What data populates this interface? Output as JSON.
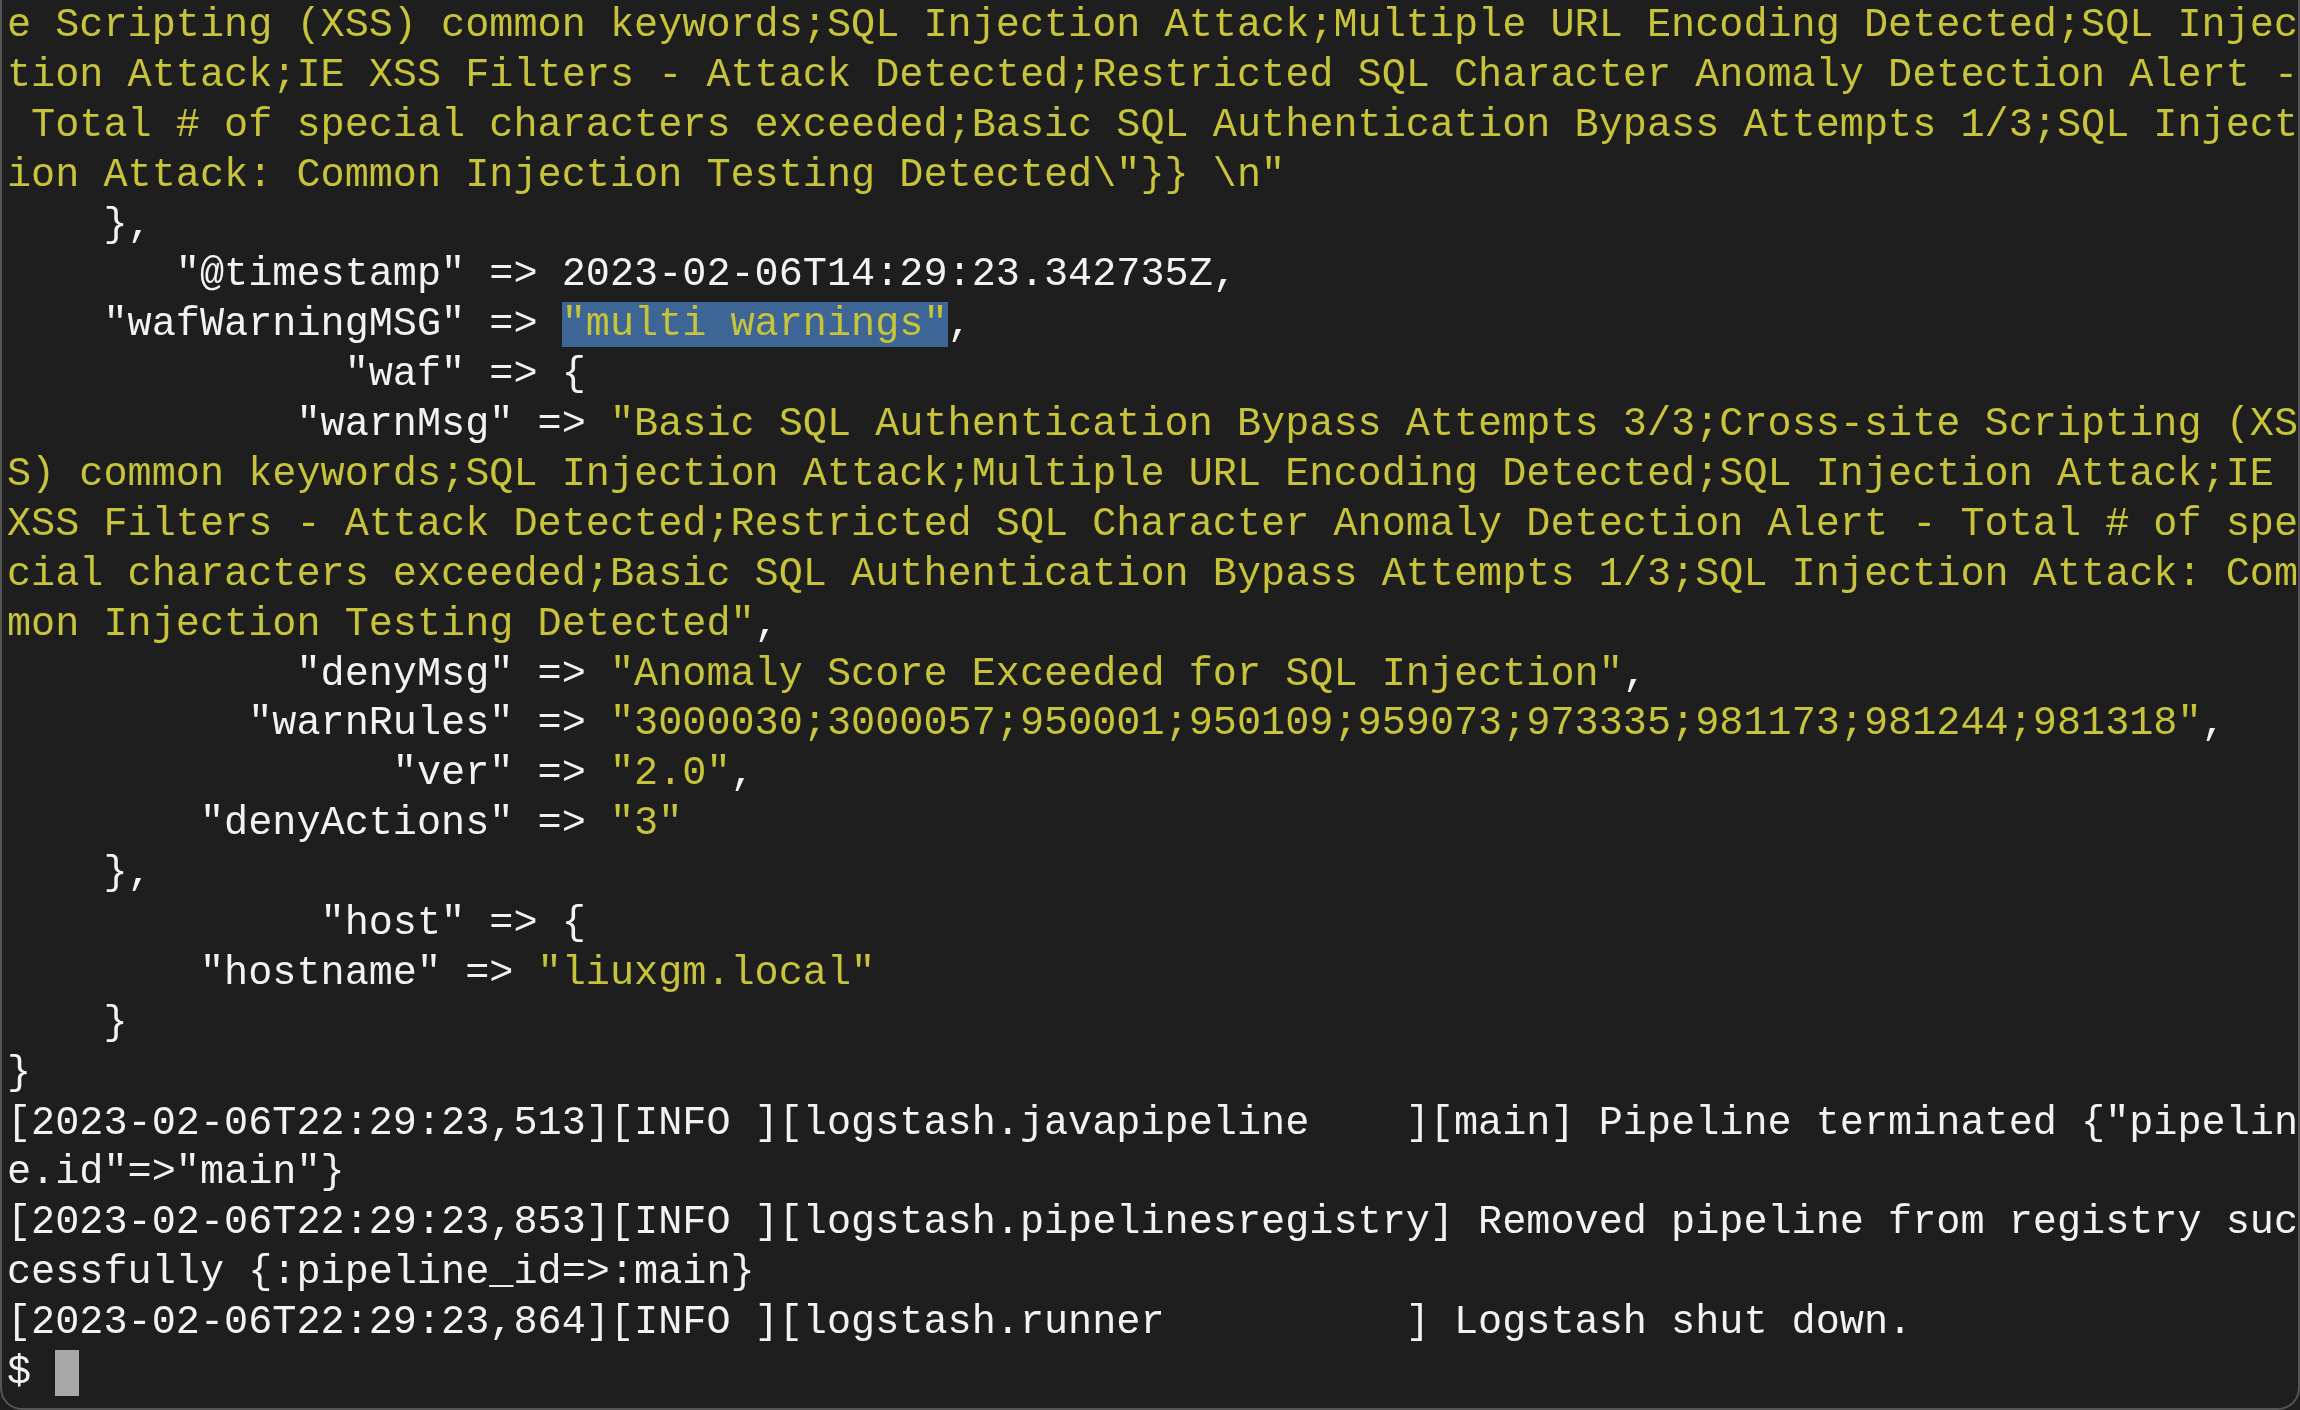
{
  "terminal": {
    "lines": [
      {
        "segments": [
          {
            "text": "e Scripting (XSS) common keywords;SQL Injection Attack;Multiple URL Encoding Detected;SQL Injec",
            "kind": "string",
            "selected": false
          }
        ]
      },
      {
        "segments": [
          {
            "text": "tion Attack;IE XSS Filters - Attack Detected;Restricted SQL Character Anomaly Detection Alert -",
            "kind": "string",
            "selected": false
          }
        ]
      },
      {
        "segments": [
          {
            "text": " Total # of special characters exceeded;Basic SQL Authentication Bypass Attempts 1/3;SQL Inject",
            "kind": "string",
            "selected": false
          }
        ]
      },
      {
        "segments": [
          {
            "text": "ion Attack: Common Injection Testing Detected\\\"}} \\n\"",
            "kind": "string",
            "selected": false
          }
        ]
      },
      {
        "segments": [
          {
            "text": "    },",
            "kind": "plain",
            "selected": false
          }
        ]
      },
      {
        "segments": [
          {
            "text": "       \"@timestamp\" => 2023-02-06T14:29:23.342735Z,",
            "kind": "plain",
            "selected": false
          }
        ]
      },
      {
        "segments": [
          {
            "text": "    \"wafWarningMSG\" => ",
            "kind": "plain",
            "selected": false
          },
          {
            "text": "\"multi warnings\"",
            "kind": "string",
            "selected": true
          },
          {
            "text": ",",
            "kind": "plain",
            "selected": false
          }
        ]
      },
      {
        "segments": [
          {
            "text": "              \"waf\" => {",
            "kind": "plain",
            "selected": false
          }
        ]
      },
      {
        "segments": [
          {
            "text": "            \"warnMsg\" => ",
            "kind": "plain",
            "selected": false
          },
          {
            "text": "\"Basic SQL Authentication Bypass Attempts 3/3;Cross-site Scripting (XS",
            "kind": "string",
            "selected": false
          }
        ]
      },
      {
        "segments": [
          {
            "text": "S) common keywords;SQL Injection Attack;Multiple URL Encoding Detected;SQL Injection Attack;IE",
            "kind": "string",
            "selected": false
          }
        ]
      },
      {
        "segments": [
          {
            "text": "XSS Filters - Attack Detected;Restricted SQL Character Anomaly Detection Alert - Total # of spe",
            "kind": "string",
            "selected": false
          }
        ]
      },
      {
        "segments": [
          {
            "text": "cial characters exceeded;Basic SQL Authentication Bypass Attempts 1/3;SQL Injection Attack: Com",
            "kind": "string",
            "selected": false
          }
        ]
      },
      {
        "segments": [
          {
            "text": "mon Injection Testing Detected\"",
            "kind": "string",
            "selected": false
          },
          {
            "text": ",",
            "kind": "plain",
            "selected": false
          }
        ]
      },
      {
        "segments": [
          {
            "text": "            \"denyMsg\" => ",
            "kind": "plain",
            "selected": false
          },
          {
            "text": "\"Anomaly Score Exceeded for SQL Injection\"",
            "kind": "string",
            "selected": false
          },
          {
            "text": ",",
            "kind": "plain",
            "selected": false
          }
        ]
      },
      {
        "segments": [
          {
            "text": "          \"warnRules\" => ",
            "kind": "plain",
            "selected": false
          },
          {
            "text": "\"3000030;3000057;950001;950109;959073;973335;981173;981244;981318\"",
            "kind": "string",
            "selected": false
          },
          {
            "text": ",",
            "kind": "plain",
            "selected": false
          }
        ]
      },
      {
        "segments": [
          {
            "text": "                \"ver\" => ",
            "kind": "plain",
            "selected": false
          },
          {
            "text": "\"2.0\"",
            "kind": "string",
            "selected": false
          },
          {
            "text": ",",
            "kind": "plain",
            "selected": false
          }
        ]
      },
      {
        "segments": [
          {
            "text": "        \"denyActions\" => ",
            "kind": "plain",
            "selected": false
          },
          {
            "text": "\"3\"",
            "kind": "string",
            "selected": false
          }
        ]
      },
      {
        "segments": [
          {
            "text": "    },",
            "kind": "plain",
            "selected": false
          }
        ]
      },
      {
        "segments": [
          {
            "text": "             \"host\" => {",
            "kind": "plain",
            "selected": false
          }
        ]
      },
      {
        "segments": [
          {
            "text": "        \"hostname\" => ",
            "kind": "plain",
            "selected": false
          },
          {
            "text": "\"liuxgm.local\"",
            "kind": "string",
            "selected": false
          }
        ]
      },
      {
        "segments": [
          {
            "text": "    }",
            "kind": "plain",
            "selected": false
          }
        ]
      },
      {
        "segments": [
          {
            "text": "}",
            "kind": "plain",
            "selected": false
          }
        ]
      },
      {
        "segments": [
          {
            "text": "[2023-02-06T22:29:23,513][INFO ][logstash.javapipeline    ][main] Pipeline terminated {\"pipelin",
            "kind": "plain",
            "selected": false
          }
        ]
      },
      {
        "segments": [
          {
            "text": "e.id\"=>\"main\"}",
            "kind": "plain",
            "selected": false
          }
        ]
      },
      {
        "segments": [
          {
            "text": "[2023-02-06T22:29:23,853][INFO ][logstash.pipelinesregistry] Removed pipeline from registry suc",
            "kind": "plain",
            "selected": false
          }
        ]
      },
      {
        "segments": [
          {
            "text": "cessfully {:pipeline_id=>:main}",
            "kind": "plain",
            "selected": false
          }
        ]
      },
      {
        "segments": [
          {
            "text": "[2023-02-06T22:29:23,864][INFO ][logstash.runner          ] Logstash shut down.",
            "kind": "plain",
            "selected": false
          }
        ]
      }
    ],
    "prompt": {
      "text": "$",
      "cursor_visible": true
    }
  }
}
